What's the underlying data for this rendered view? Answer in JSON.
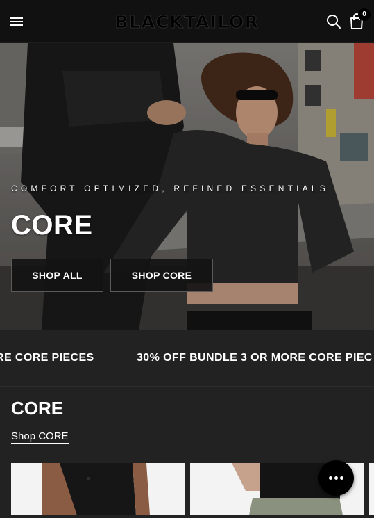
{
  "header": {
    "logo": "BLACKTAILOR",
    "cart_count": "0",
    "icons": [
      "menu-icon",
      "search-icon",
      "shopping-bag-icon"
    ]
  },
  "hero": {
    "kicker": "COMFORT OPTIMIZED, REFINED ESSENTIALS",
    "title": "CORE",
    "buttons": [
      {
        "label": "SHOP ALL"
      },
      {
        "label": "SHOP CORE"
      }
    ]
  },
  "marquee": {
    "items": [
      "RE CORE PIECES",
      "30% OFF BUNDLE 3 OR MORE CORE PIEC"
    ]
  },
  "collection": {
    "title": "CORE",
    "link": "Shop CORE"
  },
  "chat": {
    "icon": "chat-icon"
  },
  "colors": {
    "header_bg": "#111111",
    "marquee_bg": "#222222",
    "button_bg": "#141414"
  }
}
